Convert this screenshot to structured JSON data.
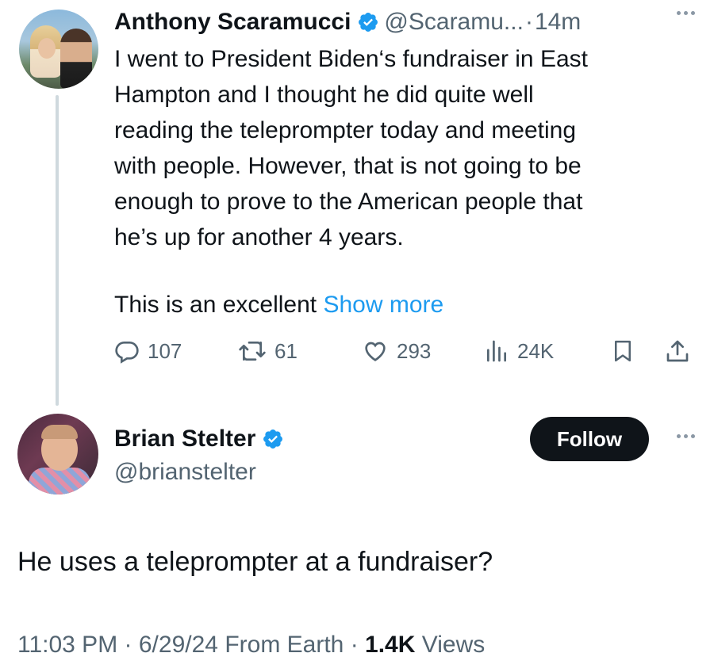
{
  "tweet1": {
    "author_name": "Anthony Scaramucci",
    "handle": "@Scaramu...",
    "separator": "·",
    "time": "14m",
    "text": "I went to President Biden‘s fundraiser in East\nHampton and I thought he did quite well\nreading the teleprompter today and meeting\nwith people. However, that is not going to be\nenough to prove to the American people that\nhe’s up for another 4 years.",
    "text_tail": "This is an excellent",
    "show_more": "Show more",
    "stats": {
      "replies": "107",
      "retweets": "61",
      "likes": "293",
      "views": "24K"
    }
  },
  "tweet2": {
    "author_name": "Brian Stelter",
    "handle": "@brianstelter",
    "follow_label": "Follow",
    "text": "He uses a teleprompter at a fundraiser?",
    "meta": {
      "time": "11:03 PM",
      "sep1": "·",
      "date": "6/29/24",
      "source": "From Earth",
      "sep2": "·",
      "views_count": "1.4K",
      "views_label": "Views"
    }
  },
  "colors": {
    "verified_blue": "#1d9bf0",
    "link_blue": "#1d9bf0",
    "secondary_text": "#536471",
    "follow_button_bg": "#0f1419"
  },
  "icons": [
    "verified-badge-icon",
    "more-icon",
    "reply-icon",
    "retweet-icon",
    "like-icon",
    "views-icon",
    "bookmark-icon",
    "share-icon"
  ]
}
